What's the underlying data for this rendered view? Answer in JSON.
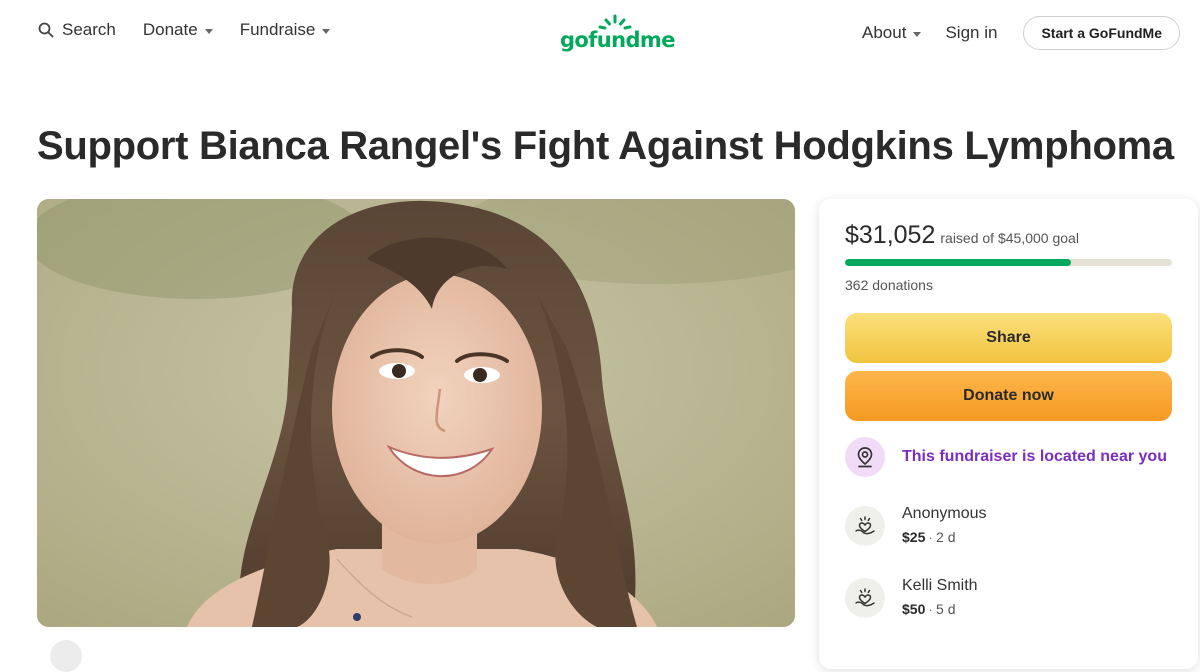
{
  "header": {
    "search_label": "Search",
    "donate_label": "Donate",
    "fundraise_label": "Fundraise",
    "logo_text": "gofundme",
    "about_label": "About",
    "signin_label": "Sign in",
    "start_label": "Start a GoFundMe"
  },
  "fundraiser": {
    "title": "Support Bianca Rangel's Fight Against Hodgkins Lymphoma"
  },
  "donation_card": {
    "raised": "$31,052",
    "goal_text": "raised of $45,000 goal",
    "progress_fraction": 0.69,
    "donation_count": "362 donations",
    "share_label": "Share",
    "donate_label": "Donate now",
    "near_text": "This fundraiser is located near you",
    "donations": [
      {
        "name": "Anonymous",
        "amount": "$25",
        "time": "2 d"
      },
      {
        "name": "Kelli Smith",
        "amount": "$50",
        "time": "5 d"
      }
    ]
  },
  "colors": {
    "brand_green": "#02a95c",
    "share_yellow": "#f3c340",
    "donate_orange": "#f59a22",
    "near_purple": "#7b2ec0"
  },
  "icons": {
    "search": "search-icon",
    "near": "location-pin-icon",
    "donor": "heart-hand-icon"
  }
}
